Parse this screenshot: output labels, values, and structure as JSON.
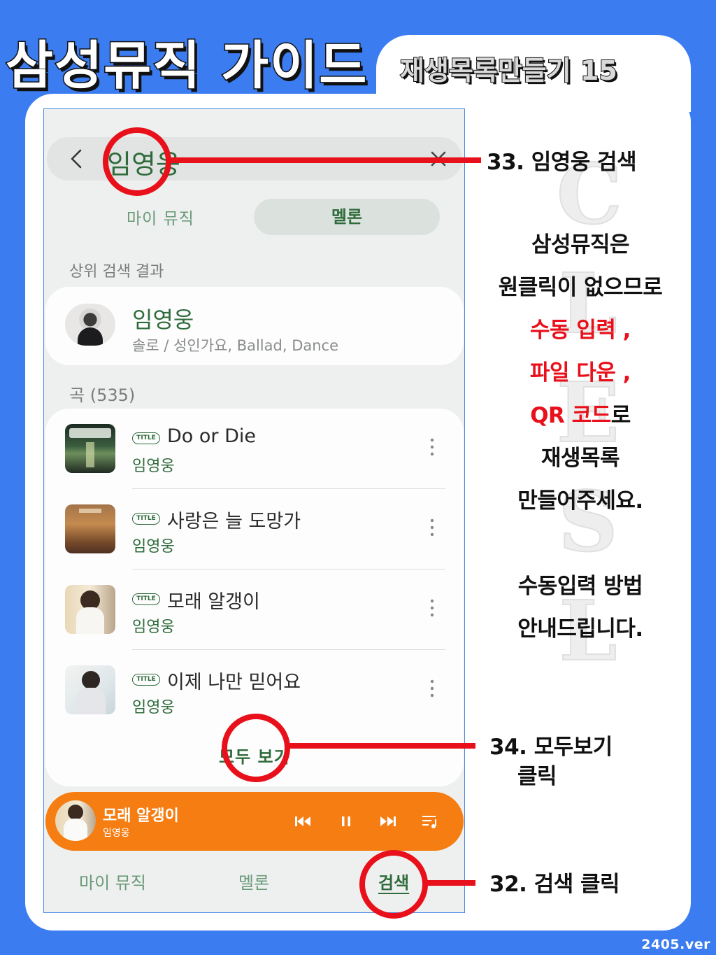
{
  "header": {
    "guide_title": "삼성뮤직 가이드",
    "subtitle": "재생목록만들기 15",
    "version": "2405.ver"
  },
  "watermark": [
    "C",
    "L",
    "E",
    "S",
    "L"
  ],
  "app": {
    "search_query": "임영웅",
    "tabs": [
      {
        "label": "마이 뮤직",
        "selected": false
      },
      {
        "label": "멜론",
        "selected": true
      }
    ],
    "top_result_heading": "상위 검색 결과",
    "top_result": {
      "name": "임영웅",
      "meta": "솔로 / 성인가요, Ballad, Dance"
    },
    "songs_heading": "곡 (535)",
    "title_badge": "TITLE",
    "songs": [
      {
        "title": "Do or Die",
        "artist": "임영웅"
      },
      {
        "title": "사랑은 늘 도망가",
        "artist": "임영웅"
      },
      {
        "title": "모래 알갱이",
        "artist": "임영웅"
      },
      {
        "title": "이제 나만 믿어요",
        "artist": "임영웅"
      }
    ],
    "see_all": "모두 보기",
    "now_playing": {
      "title": "모래 알갱이",
      "artist": "임영웅"
    },
    "bottom_nav": [
      {
        "label": "마이 뮤직"
      },
      {
        "label": "멜론"
      },
      {
        "label": "검색",
        "active": true
      }
    ],
    "colors": {
      "accent_green": "#2f6b3b",
      "player_orange": "#f57d12",
      "background_blue": "#3b7cf0",
      "annotation_red": "#e8101a"
    }
  },
  "annotations": {
    "step33": "33. 임영웅 검색",
    "step34_line1": "34. 모두보기",
    "step34_line2": "클릭",
    "step32": "32. 검색 클릭"
  },
  "description": {
    "l1": "삼성뮤직은",
    "l2": "원클릭이 없으므로",
    "l3": "수동 입력 ,",
    "l4": "파일 다운 ,",
    "l5a": "QR 코드",
    "l5b": "로",
    "l6": "재생목록",
    "l7": "만들어주세요.",
    "l8": "수동입력 방법",
    "l9": "안내드립니다."
  }
}
